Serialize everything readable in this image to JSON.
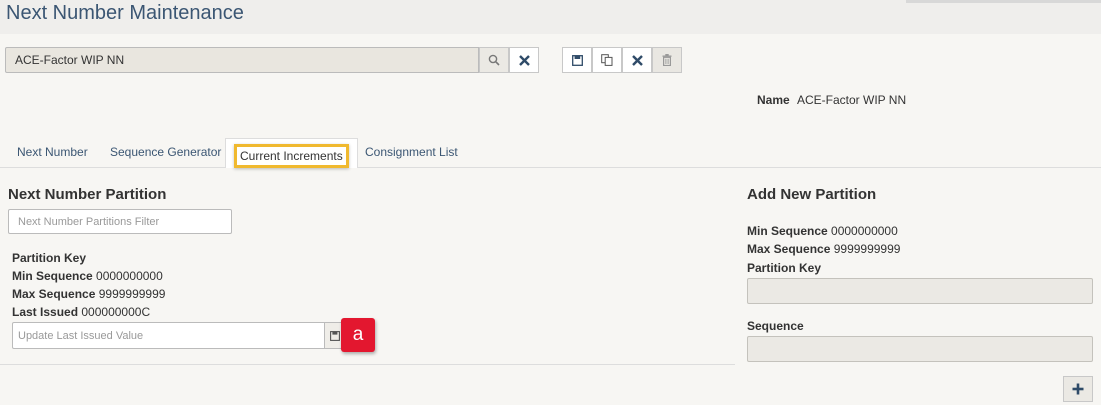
{
  "header": {
    "title": "Next Number Maintenance"
  },
  "search": {
    "value": "ACE-Factor WIP NN"
  },
  "record": {
    "name_label": "Name",
    "name_value": "ACE-Factor WIP NN"
  },
  "tabs": [
    {
      "label": "Next Number"
    },
    {
      "label": "Sequence Generator"
    },
    {
      "label": "Current Increments"
    },
    {
      "label": "Consignment List"
    }
  ],
  "partition": {
    "title": "Next Number Partition",
    "filter_placeholder": "Next Number Partitions Filter",
    "partition_key_label": "Partition Key",
    "min_seq_label": "Min Sequence",
    "min_seq_value": "0000000000",
    "max_seq_label": "Max Sequence",
    "max_seq_value": "9999999999",
    "last_issued_label": "Last Issued",
    "last_issued_value": "000000000C",
    "update_placeholder": "Update Last Issued Value",
    "callout": "a"
  },
  "add_partition": {
    "title": "Add New Partition",
    "min_seq_label": "Min Sequence",
    "min_seq_value": "0000000000",
    "max_seq_label": "Max Sequence",
    "max_seq_value": "9999999999",
    "partition_key_label": "Partition Key",
    "sequence_label": "Sequence"
  },
  "colors": {
    "callout": "#e3172f",
    "highlight": "#f0b92f",
    "title": "#3b5673"
  },
  "icons": [
    "search-icon",
    "clear-icon",
    "save-icon",
    "copy-icon",
    "close-icon",
    "delete-icon",
    "plus-icon"
  ]
}
